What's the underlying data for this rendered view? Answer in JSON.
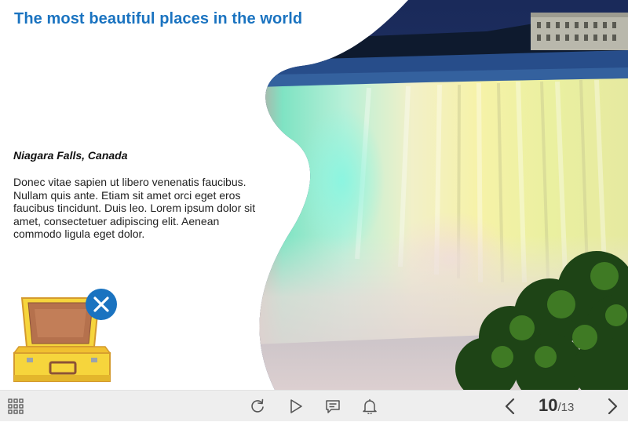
{
  "slide": {
    "title": "The most beautiful places in the world",
    "place_name": "Niagara Falls, Canada",
    "description": "Donec vitae sapien ut libero venenatis faucibus. Nullam quis ante. Etiam sit amet orci eget eros faucibus tincidunt. Duis leo. Lorem ipsum dolor sit amet, consectetuer adipiscing elit. Aenean commodo ligula eget dolor."
  },
  "toolbar": {
    "icons": [
      "menu-grid-icon",
      "replay-icon",
      "play-icon",
      "notes-icon",
      "bell-icon",
      "prev-icon",
      "next-icon"
    ],
    "current_slide": "10",
    "separator": "/",
    "total_slides": "13"
  },
  "colors": {
    "accent": "#1a73c0",
    "toolbar_bg": "#eeeeee",
    "suitcase_yellow": "#f6d53c"
  }
}
